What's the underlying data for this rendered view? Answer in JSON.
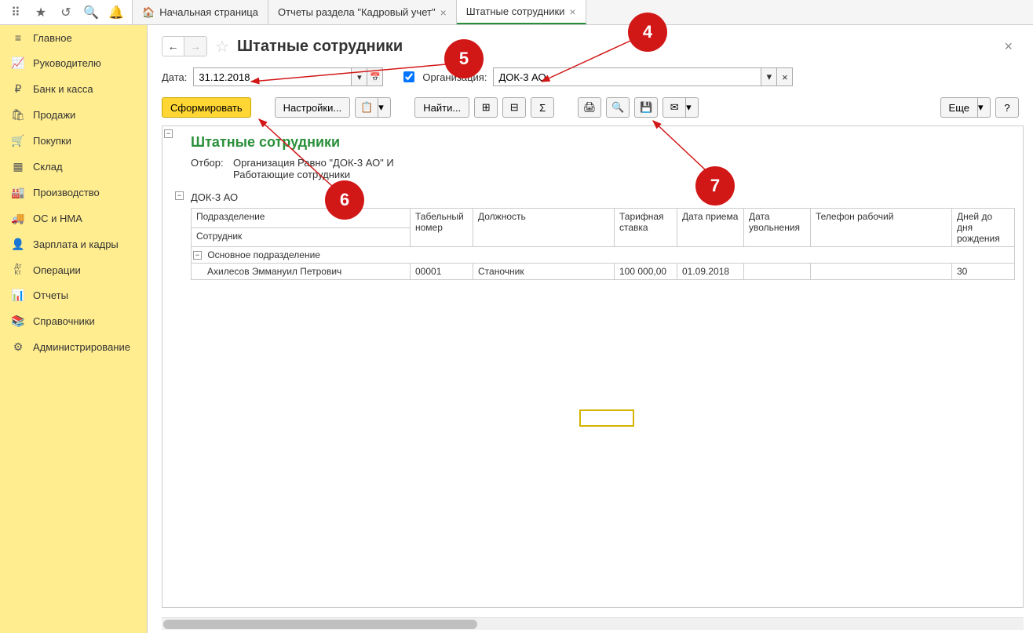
{
  "tabs": [
    {
      "label": "Начальная страница",
      "has_home_icon": true,
      "closable": false
    },
    {
      "label": "Отчеты раздела \"Кадровый учет\"",
      "closable": true
    },
    {
      "label": "Штатные сотрудники",
      "closable": true,
      "active": true
    }
  ],
  "sidebar": {
    "items": [
      {
        "label": "Главное",
        "icon": "≡"
      },
      {
        "label": "Руководителю",
        "icon": "📈"
      },
      {
        "label": "Банк и касса",
        "icon": "₽"
      },
      {
        "label": "Продажи",
        "icon": "🛍"
      },
      {
        "label": "Покупки",
        "icon": "🛒"
      },
      {
        "label": "Склад",
        "icon": "▦"
      },
      {
        "label": "Производство",
        "icon": "🏭"
      },
      {
        "label": "ОС и НМА",
        "icon": "🚚"
      },
      {
        "label": "Зарплата и кадры",
        "icon": "👤"
      },
      {
        "label": "Операции",
        "icon": "Дт Кт"
      },
      {
        "label": "Отчеты",
        "icon": "📊"
      },
      {
        "label": "Справочники",
        "icon": "📚"
      },
      {
        "label": "Администрирование",
        "icon": "⚙"
      }
    ]
  },
  "page": {
    "title": "Штатные сотрудники"
  },
  "filters": {
    "date_label": "Дата:",
    "date_value": "31.12.2018",
    "org_checked": true,
    "org_label": "Организация:",
    "org_value": "ДОК-3 АО"
  },
  "actions": {
    "generate": "Сформировать",
    "settings": "Настройки...",
    "find": "Найти...",
    "more": "Еще",
    "help": "?"
  },
  "report": {
    "title": "Штатные сотрудники",
    "filter_label": "Отбор:",
    "filter_text_1": "Организация Равно \"ДОК-3 АО\" И",
    "filter_text_2": "Работающие сотрудники",
    "org": "ДОК-3 АО",
    "headers": {
      "department": "Подразделение",
      "employee": "Сотрудник",
      "tab_number": "Табельный номер",
      "position": "Должность",
      "rate": "Тарифная ставка",
      "hire_date": "Дата приема",
      "fire_date": "Дата увольнения",
      "work_phone": "Телефон рабочий",
      "days_to_bday": "Дней до дня рождения"
    },
    "rows": [
      {
        "department": "Основное подразделение",
        "employees": [
          {
            "name": "Ахилесов Эммануил Петрович",
            "tab_number": "00001",
            "position": "Станочник",
            "rate": "100 000,00",
            "hire_date": "01.09.2018",
            "fire_date": "",
            "work_phone": "",
            "days_to_bday": "30"
          }
        ]
      }
    ]
  },
  "annotations": {
    "a4": "4",
    "a5": "5",
    "a6": "6",
    "a7": "7"
  }
}
